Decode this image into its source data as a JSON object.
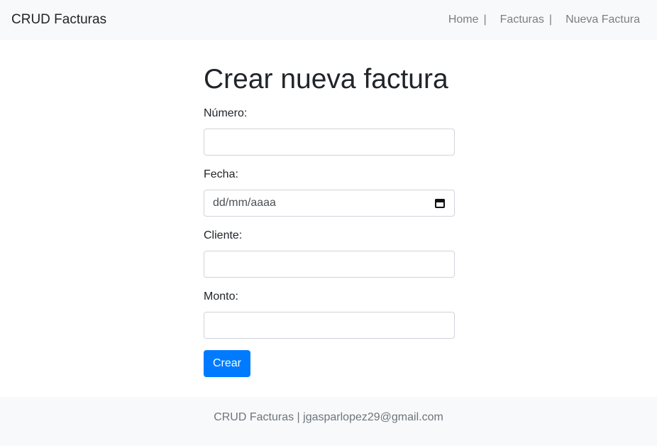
{
  "navbar": {
    "brand": "CRUD Facturas",
    "links": [
      {
        "label": "Home",
        "separator": "|"
      },
      {
        "label": "Facturas",
        "separator": "|"
      },
      {
        "label": "Nueva Factura"
      }
    ]
  },
  "form": {
    "title": "Crear nueva factura",
    "fields": [
      {
        "label": "Número:",
        "value": "",
        "placeholder": ""
      },
      {
        "label": "Fecha:",
        "value": "dd/mm/aaaa",
        "icon": "calendar-icon"
      },
      {
        "label": "Cliente:",
        "value": "",
        "placeholder": ""
      },
      {
        "label": "Monto:",
        "value": "",
        "placeholder": ""
      }
    ],
    "submit_label": "Crear"
  },
  "footer": {
    "text": "CRUD Facturas | jgasparlopez29@gmail.com"
  },
  "colors": {
    "accent": "#007bff",
    "navbar_bg": "#f8f9fa",
    "text": "#212529",
    "muted": "#6c757d"
  }
}
